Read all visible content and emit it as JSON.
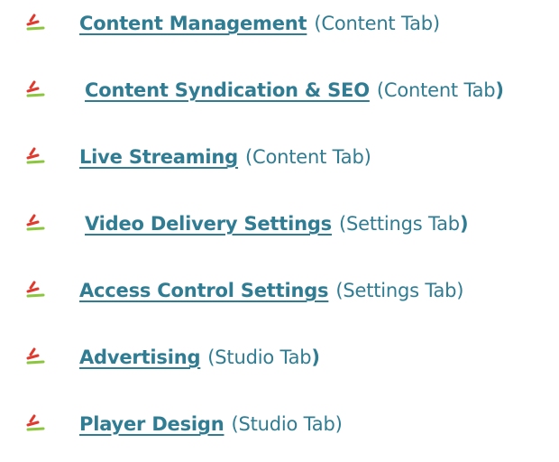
{
  "items": [
    {
      "link": "Content Management",
      "tab": "(Content Tab)"
    },
    {
      "link": "Content Syndication & SEO",
      "tab_text": "(Content Tab",
      "tab_close": ")"
    },
    {
      "link": "Live Streaming",
      "tab": "(Content Tab)"
    },
    {
      "link": "Video Delivery Settings",
      "tab_text": "(Settings Tab",
      "tab_close": ")"
    },
    {
      "link": "Access Control Settings",
      "tab": "(Settings Tab)"
    },
    {
      "link": "Advertising",
      "tab_text": "(Studio Tab",
      "tab_close": ")"
    },
    {
      "link": "Player Design",
      "tab": "(Studio Tab)"
    }
  ],
  "colors": {
    "link": "#2f7c93",
    "bullet_red": "#e03a2f",
    "bullet_green": "#8cc63f"
  }
}
